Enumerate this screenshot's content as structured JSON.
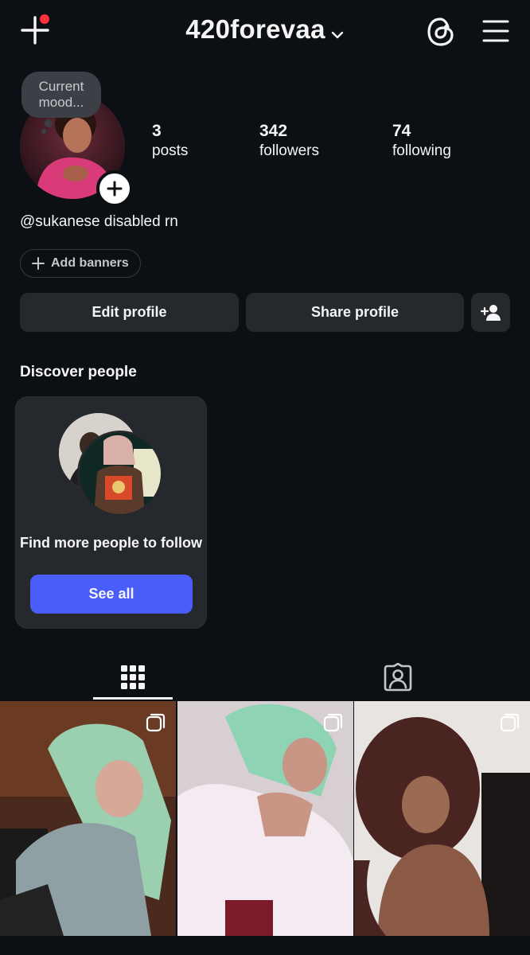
{
  "header": {
    "username": "420forevaa",
    "icons": [
      "new-post-icon",
      "chevron-down-icon",
      "threads-icon",
      "menu-icon"
    ],
    "notification_color": "#ff3040"
  },
  "profile": {
    "mood_note": "Current mood...",
    "bio": "@sukanese disabled rn",
    "stats": [
      {
        "value": "3",
        "label": "posts"
      },
      {
        "value": "342",
        "label": "followers"
      },
      {
        "value": "74",
        "label": "following"
      }
    ],
    "add_banners_label": "Add banners"
  },
  "actions": {
    "edit_profile": "Edit profile",
    "share_profile": "Share profile"
  },
  "discover": {
    "title": "Discover people",
    "card_text": "Find more people to follow",
    "see_all": "See all",
    "accent_color": "#4a5df9"
  },
  "tabs": [
    {
      "name": "posts-grid-tab",
      "icon": "grid-icon",
      "active": true
    },
    {
      "name": "tagged-tab",
      "icon": "person-tag-icon",
      "active": false
    }
  ],
  "posts": [
    {
      "icon": "carousel-icon"
    },
    {
      "icon": "carousel-icon"
    },
    {
      "icon": "carousel-icon"
    }
  ]
}
